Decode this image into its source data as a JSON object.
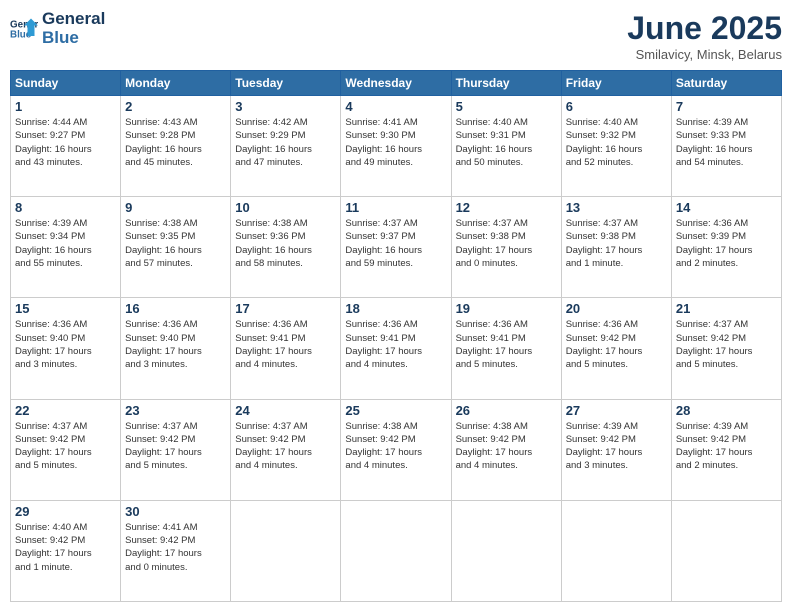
{
  "header": {
    "logo_line1": "General",
    "logo_line2": "Blue",
    "month": "June 2025",
    "location": "Smilavicy, Minsk, Belarus"
  },
  "weekdays": [
    "Sunday",
    "Monday",
    "Tuesday",
    "Wednesday",
    "Thursday",
    "Friday",
    "Saturday"
  ],
  "weeks": [
    [
      {
        "day": "1",
        "info": "Sunrise: 4:44 AM\nSunset: 9:27 PM\nDaylight: 16 hours\nand 43 minutes."
      },
      {
        "day": "2",
        "info": "Sunrise: 4:43 AM\nSunset: 9:28 PM\nDaylight: 16 hours\nand 45 minutes."
      },
      {
        "day": "3",
        "info": "Sunrise: 4:42 AM\nSunset: 9:29 PM\nDaylight: 16 hours\nand 47 minutes."
      },
      {
        "day": "4",
        "info": "Sunrise: 4:41 AM\nSunset: 9:30 PM\nDaylight: 16 hours\nand 49 minutes."
      },
      {
        "day": "5",
        "info": "Sunrise: 4:40 AM\nSunset: 9:31 PM\nDaylight: 16 hours\nand 50 minutes."
      },
      {
        "day": "6",
        "info": "Sunrise: 4:40 AM\nSunset: 9:32 PM\nDaylight: 16 hours\nand 52 minutes."
      },
      {
        "day": "7",
        "info": "Sunrise: 4:39 AM\nSunset: 9:33 PM\nDaylight: 16 hours\nand 54 minutes."
      }
    ],
    [
      {
        "day": "8",
        "info": "Sunrise: 4:39 AM\nSunset: 9:34 PM\nDaylight: 16 hours\nand 55 minutes."
      },
      {
        "day": "9",
        "info": "Sunrise: 4:38 AM\nSunset: 9:35 PM\nDaylight: 16 hours\nand 57 minutes."
      },
      {
        "day": "10",
        "info": "Sunrise: 4:38 AM\nSunset: 9:36 PM\nDaylight: 16 hours\nand 58 minutes."
      },
      {
        "day": "11",
        "info": "Sunrise: 4:37 AM\nSunset: 9:37 PM\nDaylight: 16 hours\nand 59 minutes."
      },
      {
        "day": "12",
        "info": "Sunrise: 4:37 AM\nSunset: 9:38 PM\nDaylight: 17 hours\nand 0 minutes."
      },
      {
        "day": "13",
        "info": "Sunrise: 4:37 AM\nSunset: 9:38 PM\nDaylight: 17 hours\nand 1 minute."
      },
      {
        "day": "14",
        "info": "Sunrise: 4:36 AM\nSunset: 9:39 PM\nDaylight: 17 hours\nand 2 minutes."
      }
    ],
    [
      {
        "day": "15",
        "info": "Sunrise: 4:36 AM\nSunset: 9:40 PM\nDaylight: 17 hours\nand 3 minutes."
      },
      {
        "day": "16",
        "info": "Sunrise: 4:36 AM\nSunset: 9:40 PM\nDaylight: 17 hours\nand 3 minutes."
      },
      {
        "day": "17",
        "info": "Sunrise: 4:36 AM\nSunset: 9:41 PM\nDaylight: 17 hours\nand 4 minutes."
      },
      {
        "day": "18",
        "info": "Sunrise: 4:36 AM\nSunset: 9:41 PM\nDaylight: 17 hours\nand 4 minutes."
      },
      {
        "day": "19",
        "info": "Sunrise: 4:36 AM\nSunset: 9:41 PM\nDaylight: 17 hours\nand 5 minutes."
      },
      {
        "day": "20",
        "info": "Sunrise: 4:36 AM\nSunset: 9:42 PM\nDaylight: 17 hours\nand 5 minutes."
      },
      {
        "day": "21",
        "info": "Sunrise: 4:37 AM\nSunset: 9:42 PM\nDaylight: 17 hours\nand 5 minutes."
      }
    ],
    [
      {
        "day": "22",
        "info": "Sunrise: 4:37 AM\nSunset: 9:42 PM\nDaylight: 17 hours\nand 5 minutes."
      },
      {
        "day": "23",
        "info": "Sunrise: 4:37 AM\nSunset: 9:42 PM\nDaylight: 17 hours\nand 5 minutes."
      },
      {
        "day": "24",
        "info": "Sunrise: 4:37 AM\nSunset: 9:42 PM\nDaylight: 17 hours\nand 4 minutes."
      },
      {
        "day": "25",
        "info": "Sunrise: 4:38 AM\nSunset: 9:42 PM\nDaylight: 17 hours\nand 4 minutes."
      },
      {
        "day": "26",
        "info": "Sunrise: 4:38 AM\nSunset: 9:42 PM\nDaylight: 17 hours\nand 4 minutes."
      },
      {
        "day": "27",
        "info": "Sunrise: 4:39 AM\nSunset: 9:42 PM\nDaylight: 17 hours\nand 3 minutes."
      },
      {
        "day": "28",
        "info": "Sunrise: 4:39 AM\nSunset: 9:42 PM\nDaylight: 17 hours\nand 2 minutes."
      }
    ],
    [
      {
        "day": "29",
        "info": "Sunrise: 4:40 AM\nSunset: 9:42 PM\nDaylight: 17 hours\nand 1 minute."
      },
      {
        "day": "30",
        "info": "Sunrise: 4:41 AM\nSunset: 9:42 PM\nDaylight: 17 hours\nand 0 minutes."
      },
      {
        "day": "",
        "info": ""
      },
      {
        "day": "",
        "info": ""
      },
      {
        "day": "",
        "info": ""
      },
      {
        "day": "",
        "info": ""
      },
      {
        "day": "",
        "info": ""
      }
    ]
  ]
}
